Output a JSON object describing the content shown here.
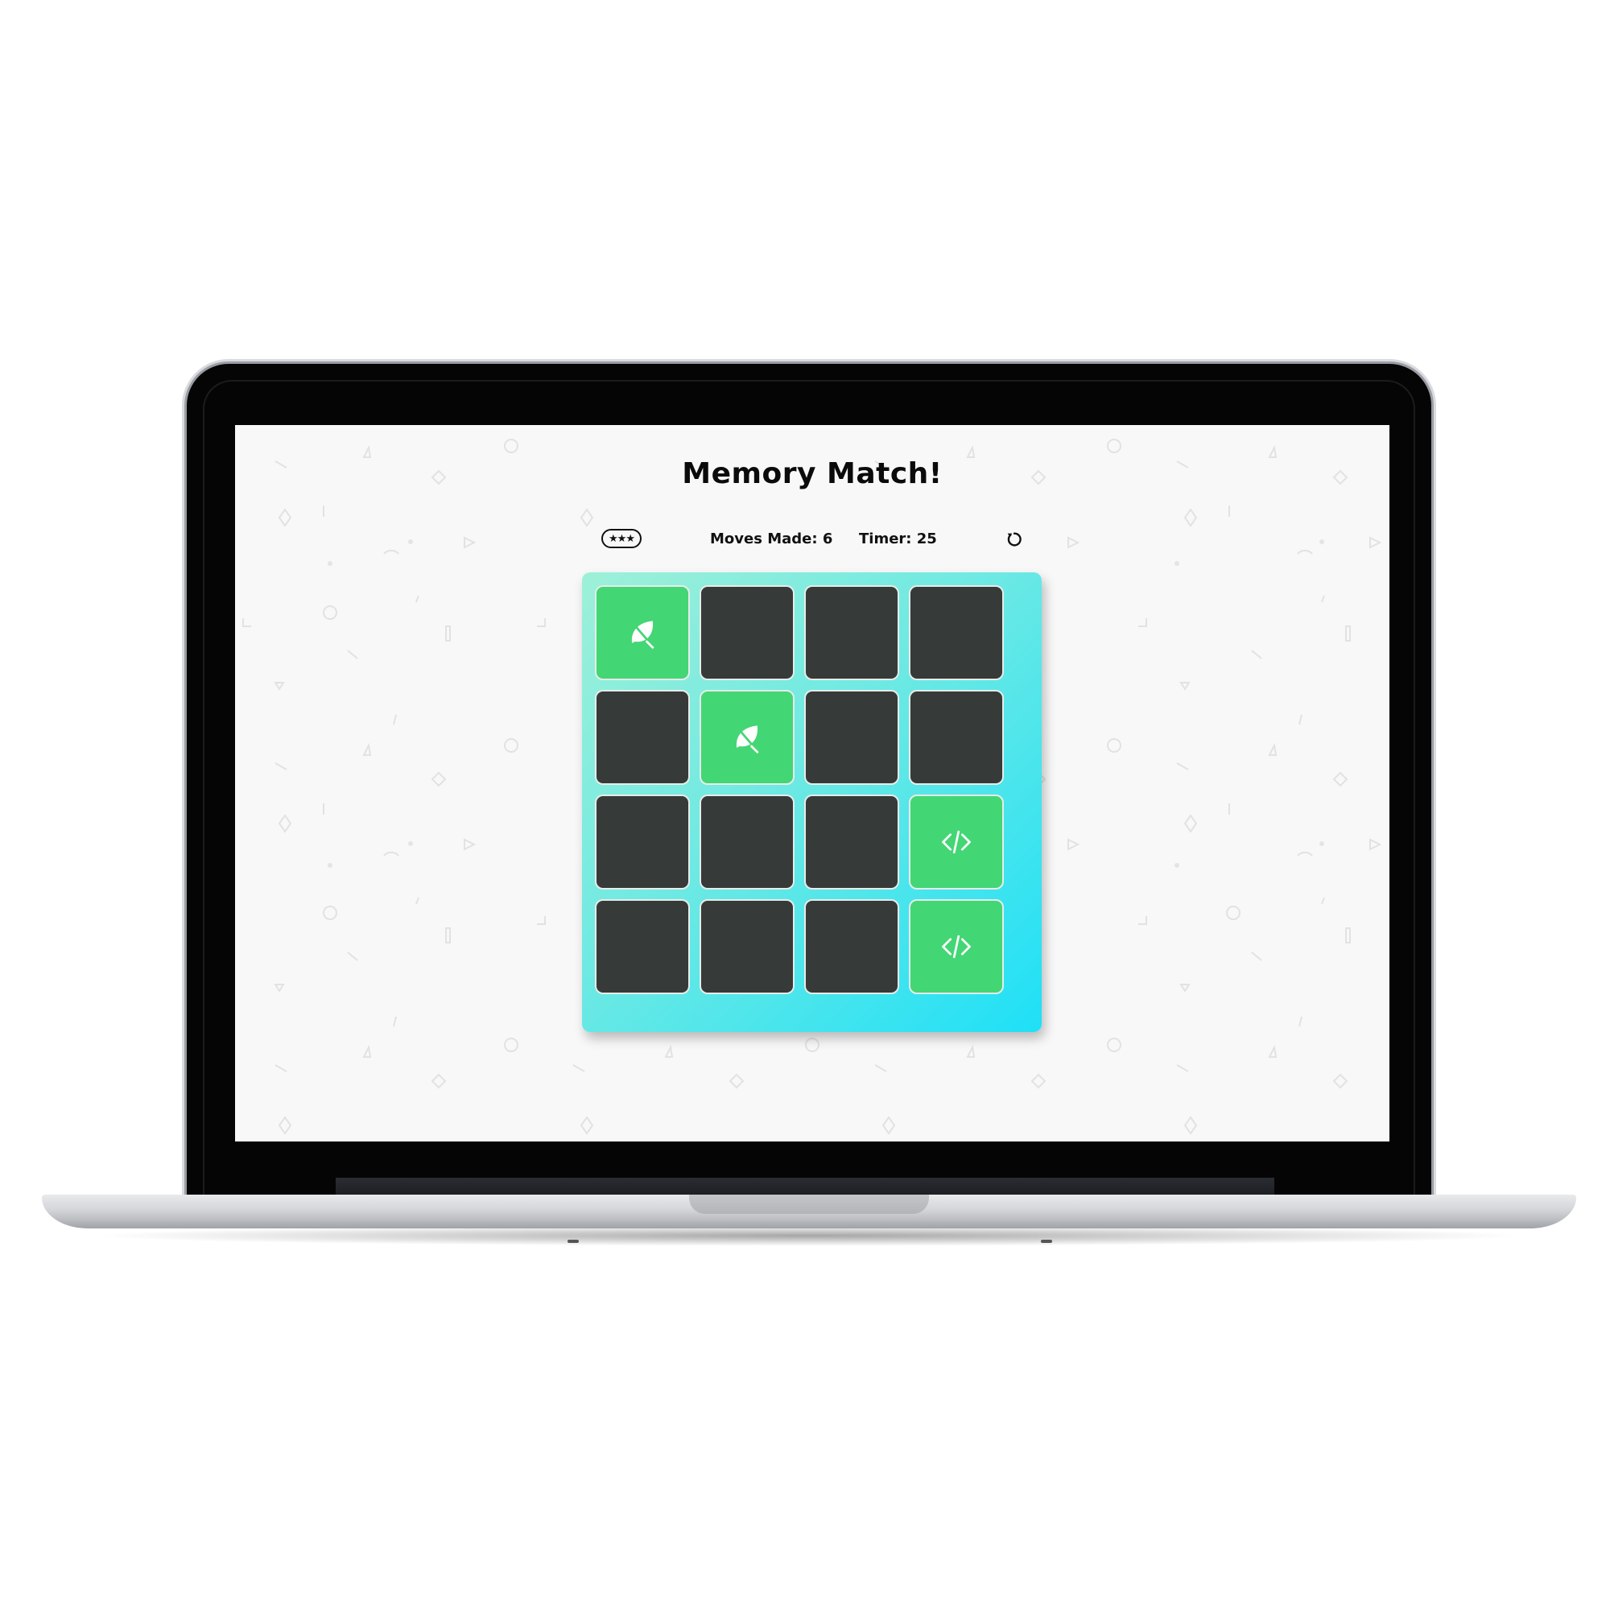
{
  "game": {
    "title": "Memory Match!",
    "stars_display": "★★★",
    "stars": 3,
    "moves_label": "Moves Made: 6",
    "moves": 6,
    "timer_label": "Timer: 25",
    "timer": 25,
    "restart_icon": "restart-icon"
  },
  "colors": {
    "card_closed": "#363a38",
    "card_open": "#43d674",
    "deck_gradient_start": "#9ef0d8",
    "deck_gradient_end": "#1fe0f7",
    "screen_background": "#f8f8f8"
  },
  "deck": {
    "rows": 4,
    "cols": 4,
    "cards": [
      {
        "row": 1,
        "col": 1,
        "state": "open",
        "icon": "leaf-icon"
      },
      {
        "row": 1,
        "col": 2,
        "state": "closed",
        "icon": ""
      },
      {
        "row": 1,
        "col": 3,
        "state": "closed",
        "icon": ""
      },
      {
        "row": 1,
        "col": 4,
        "state": "closed",
        "icon": ""
      },
      {
        "row": 2,
        "col": 1,
        "state": "closed",
        "icon": ""
      },
      {
        "row": 2,
        "col": 2,
        "state": "open",
        "icon": "leaf-icon"
      },
      {
        "row": 2,
        "col": 3,
        "state": "closed",
        "icon": ""
      },
      {
        "row": 2,
        "col": 4,
        "state": "closed",
        "icon": ""
      },
      {
        "row": 3,
        "col": 1,
        "state": "closed",
        "icon": ""
      },
      {
        "row": 3,
        "col": 2,
        "state": "closed",
        "icon": ""
      },
      {
        "row": 3,
        "col": 3,
        "state": "closed",
        "icon": ""
      },
      {
        "row": 3,
        "col": 4,
        "state": "open",
        "icon": "code-icon"
      },
      {
        "row": 4,
        "col": 1,
        "state": "closed",
        "icon": ""
      },
      {
        "row": 4,
        "col": 2,
        "state": "closed",
        "icon": ""
      },
      {
        "row": 4,
        "col": 3,
        "state": "closed",
        "icon": ""
      },
      {
        "row": 4,
        "col": 4,
        "state": "open",
        "icon": "code-icon"
      }
    ]
  }
}
